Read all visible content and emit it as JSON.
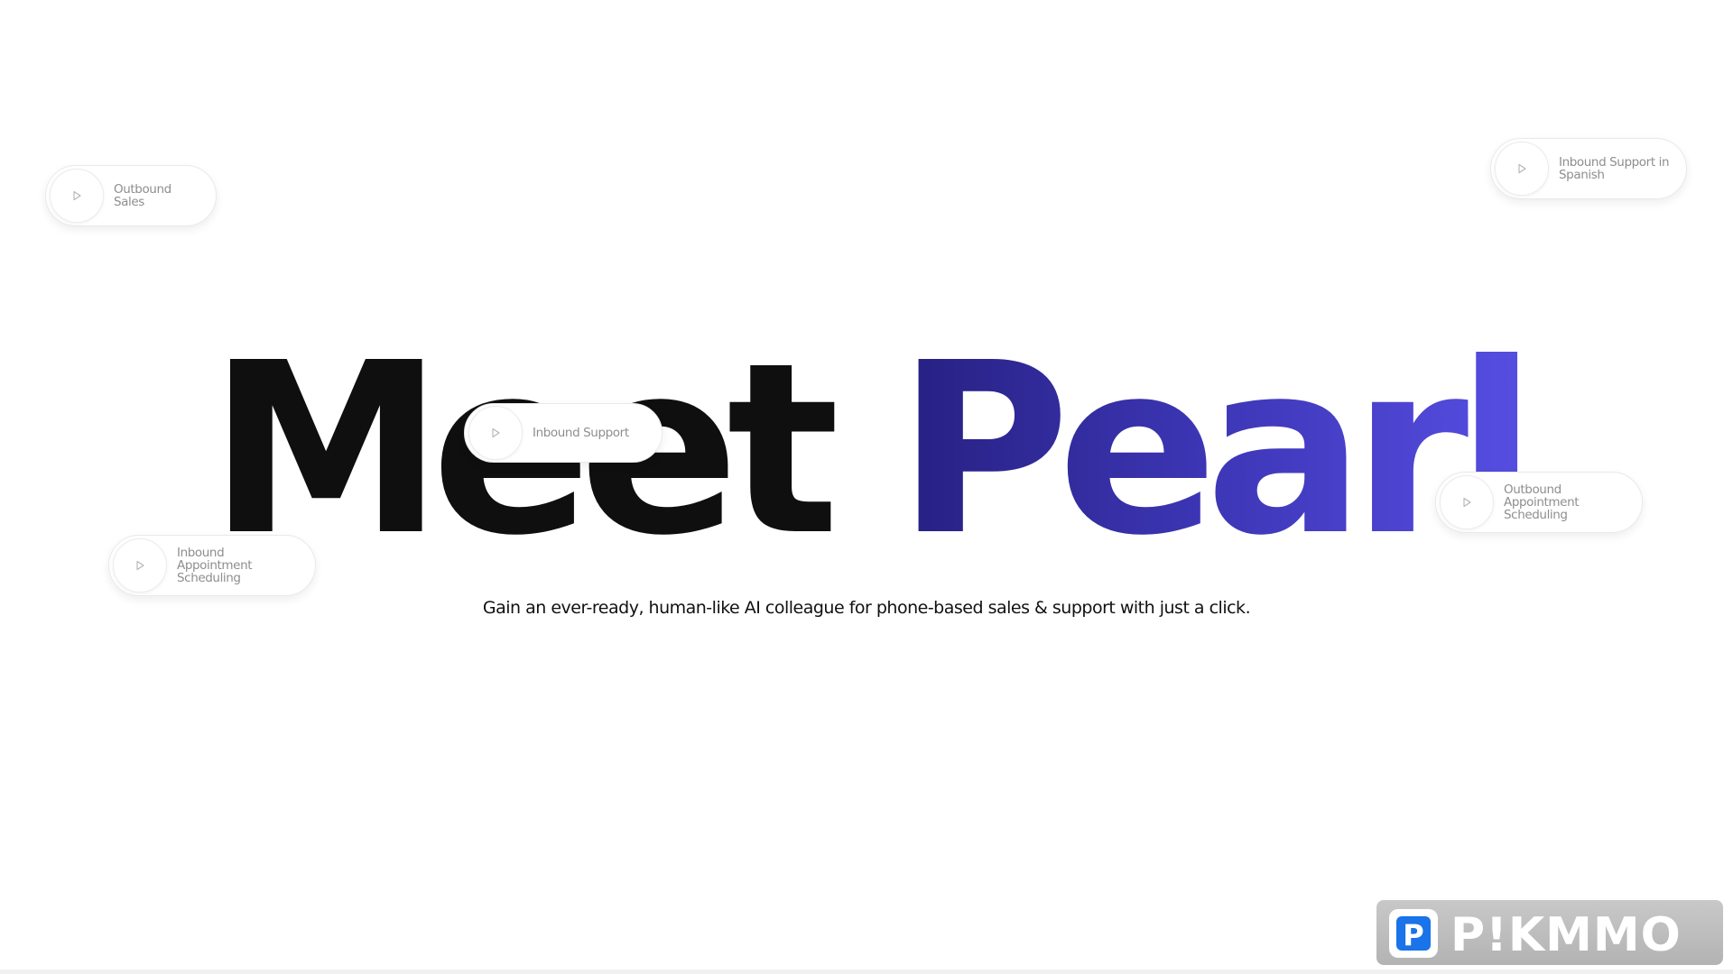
{
  "hero": {
    "title_part1": "Meet",
    "title_part2": "Pearl",
    "tagline": "Gain an ever-ready, human-like AI colleague for phone-based sales & support with just a click."
  },
  "demos": {
    "outbound_sales": "Outbound Sales",
    "inbound_support_spanish": "Inbound Support in Spanish",
    "inbound_support": "Inbound Support",
    "outbound_appointment": "Outbound Appointment Scheduling",
    "inbound_appointment": "Inbound Appointment Scheduling"
  },
  "icons": {
    "play": "play-icon",
    "watermark_logo": "pikmmo-logo"
  },
  "colors": {
    "heading_dark": "#0f0f0f",
    "gradient_start": "#262081",
    "gradient_end": "#564ee2",
    "pill_text": "#8e8e8e",
    "watermark_blue": "#1a73e8"
  },
  "watermark": {
    "text": "P!KMMO"
  }
}
